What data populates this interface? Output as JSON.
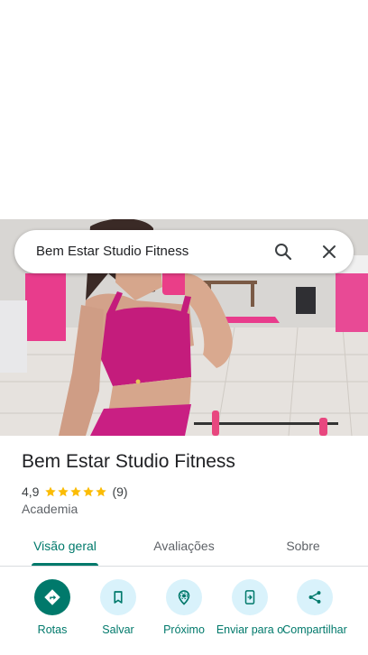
{
  "search": {
    "query": "Bem Estar Studio Fitness"
  },
  "place": {
    "name": "Bem Estar Studio Fitness",
    "rating": "4,9",
    "stars": 5,
    "review_count": "(9)",
    "category": "Academia"
  },
  "tabs": [
    {
      "label": "Visão geral",
      "active": true
    },
    {
      "label": "Avaliações",
      "active": false
    },
    {
      "label": "Sobre",
      "active": false
    }
  ],
  "actions": [
    {
      "label": "Rotas",
      "icon": "directions-icon"
    },
    {
      "label": "Salvar",
      "icon": "bookmark-icon"
    },
    {
      "label": "Próximo",
      "icon": "nearby-icon"
    },
    {
      "label": "Enviar para o",
      "icon": "send-to-phone-icon"
    },
    {
      "label": "Compartilhar",
      "icon": "share-icon"
    }
  ],
  "colors": {
    "accent": "#00796b",
    "action_bg": "#d9f2fb",
    "star": "#fbbc04",
    "text_primary": "#202124",
    "text_secondary": "#5f6368"
  }
}
